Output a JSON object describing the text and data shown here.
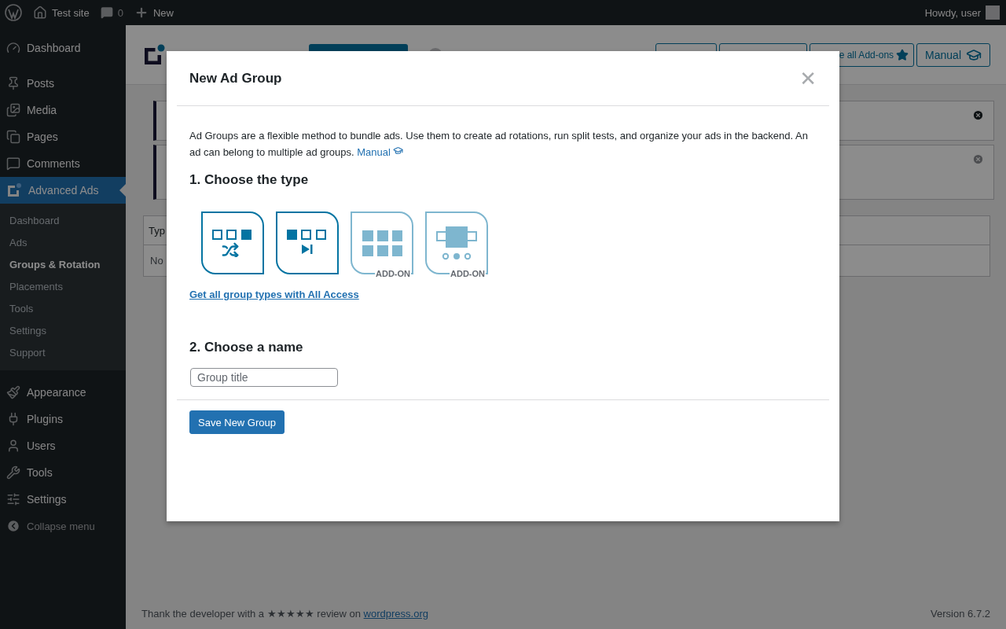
{
  "admin_bar": {
    "site": "Test site",
    "comments": "0",
    "new": "New",
    "greeting": "Howdy, user"
  },
  "sidebar": {
    "items": [
      {
        "kind": "dashboard",
        "label": "Dashboard",
        "selected": false
      },
      {
        "kind": "posts",
        "label": "Posts",
        "selected": false
      },
      {
        "kind": "media",
        "label": "Media",
        "selected": false
      },
      {
        "kind": "pages",
        "label": "Pages",
        "selected": false
      },
      {
        "kind": "comments",
        "label": "Comments",
        "selected": false
      },
      {
        "kind": "ads",
        "label": "Advanced Ads",
        "selected": true,
        "children": [
          {
            "label": "Dashboard",
            "selected": false
          },
          {
            "label": "Ads",
            "selected": false
          },
          {
            "label": "Groups & Rotation",
            "selected": true
          },
          {
            "label": "Placements",
            "selected": false
          },
          {
            "label": "Tools",
            "selected": false
          },
          {
            "label": "Settings",
            "selected": false
          },
          {
            "label": "Support",
            "selected": false
          }
        ]
      },
      {
        "kind": "appearance",
        "label": "Appearance",
        "selected": false
      },
      {
        "kind": "plugins",
        "label": "Plugins",
        "selected": false
      },
      {
        "kind": "users",
        "label": "Users",
        "selected": false
      },
      {
        "kind": "tools",
        "label": "Tools",
        "selected": false
      },
      {
        "kind": "settings",
        "label": "Settings",
        "selected": false
      }
    ],
    "collapse": "Collapse menu"
  },
  "header_buttons": [
    {
      "kind": "star",
      "label": "e all Add-ons"
    },
    {
      "kind": "cap",
      "label": "Manual"
    }
  ],
  "table": {
    "columns": [
      "Typ"
    ],
    "rows": [
      [
        "No"
      ]
    ]
  },
  "footer": {
    "text": "Thank the developer with a ★★★★★ review on",
    "link": "wordpress.org",
    "version": "Version 6.7.2"
  },
  "modal": {
    "title": "New Ad Group",
    "close": "✕",
    "intro": "Ad Groups are a flexible method to bundle ads. Use them to create ad rotations, run split tests, and organize your ads in the backend. An ad can belong to multiple ad groups.",
    "manual_link": "Manual",
    "step1": "1. Choose the type",
    "types": [
      {
        "kind": "random",
        "addon": false
      },
      {
        "kind": "ordered",
        "addon": false
      },
      {
        "kind": "grid",
        "addon": true,
        "badge": "ADD-ON"
      },
      {
        "kind": "slider",
        "addon": true,
        "badge": "ADD-ON"
      }
    ],
    "upgrade_link": "Get all group types with All Access",
    "step2": "2. Choose a name",
    "name_field": {
      "placeholder": "Group title"
    },
    "save_button": "Save New Group"
  }
}
